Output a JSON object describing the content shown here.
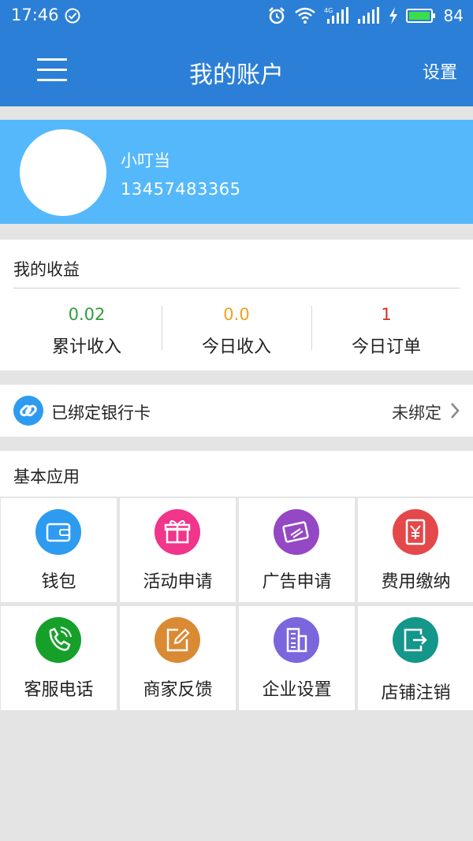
{
  "status_bar": {
    "time": "17:46",
    "network": "4G",
    "battery": "84"
  },
  "header": {
    "title": "我的账户",
    "settings_label": "设置"
  },
  "profile": {
    "name": "小叮当",
    "phone": "13457483365"
  },
  "earnings": {
    "title": "我的收益",
    "stats": [
      {
        "value": "0.02",
        "label": "累计收入",
        "color": "#2e9e3a"
      },
      {
        "value": "0.0",
        "label": "今日收入",
        "color": "#f0a020"
      },
      {
        "value": "1",
        "label": "今日订单",
        "color": "#d0302a"
      }
    ]
  },
  "bank": {
    "label": "已绑定银行卡",
    "status": "未绑定",
    "icon": "link-icon"
  },
  "apps": {
    "title": "基本应用",
    "items": [
      {
        "label": "钱包",
        "icon": "wallet-icon",
        "color": "#2d9bf0"
      },
      {
        "label": "活动申请",
        "icon": "gift-icon",
        "color": "#f0358a"
      },
      {
        "label": "广告申请",
        "icon": "card-icon",
        "color": "#9448c4"
      },
      {
        "label": "费用缴纳",
        "icon": "yen-icon",
        "color": "#e4484a"
      },
      {
        "label": "客服电话",
        "icon": "phone-icon",
        "color": "#16a02a"
      },
      {
        "label": "商家反馈",
        "icon": "edit-icon",
        "color": "#d98a33"
      },
      {
        "label": "企业设置",
        "icon": "building-icon",
        "color": "#7b66dd"
      },
      {
        "label": "店铺注销",
        "icon": "exit-icon",
        "color": "#15968a"
      }
    ]
  }
}
